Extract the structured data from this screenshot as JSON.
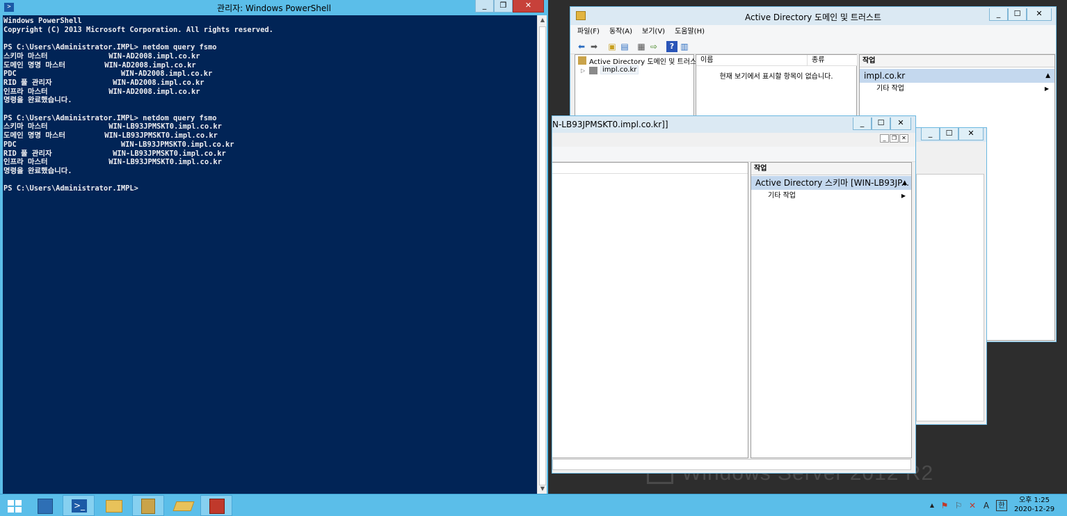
{
  "desktop": {
    "watermark": "Windows Server 2012 R2"
  },
  "powershell": {
    "title": "관리자: Windows PowerShell",
    "lines": [
      "Windows PowerShell",
      "Copyright (C) 2013 Microsoft Corporation. All rights reserved.",
      "",
      "PS C:\\Users\\Administrator.IMPL> netdom query fsmo",
      "스키마 마스터              WIN-AD2008.impl.co.kr",
      "도메인 명명 마스터         WIN-AD2008.impl.co.kr",
      "PDC                        WIN-AD2008.impl.co.kr",
      "RID 풀 관리자              WIN-AD2008.impl.co.kr",
      "인프라 마스터              WIN-AD2008.impl.co.kr",
      "명령을 완료했습니다.",
      "",
      "PS C:\\Users\\Administrator.IMPL> netdom query fsmo",
      "스키마 마스터              WIN-LB93JPMSKT0.impl.co.kr",
      "도메인 명명 마스터         WIN-LB93JPMSKT0.impl.co.kr",
      "PDC                        WIN-LB93JPMSKT0.impl.co.kr",
      "RID 풀 관리자              WIN-LB93JPMSKT0.impl.co.kr",
      "인프라 마스터              WIN-LB93JPMSKT0.impl.co.kr",
      "명령을 완료했습니다.",
      "",
      "PS C:\\Users\\Administrator.IMPL>"
    ]
  },
  "ad_trusts": {
    "title": "Active Directory 도메인 및 트러스트",
    "menu": [
      "파일(F)",
      "동작(A)",
      "보기(V)",
      "도움말(H)"
    ],
    "tree_root": "Active Directory 도메인 및 트러스트",
    "tree_child": "impl.co.kr",
    "columns": [
      "이름",
      "종류"
    ],
    "empty_message": "현재 보기에서 표시할 항목이 없습니다.",
    "actions_header": "작업",
    "actions_selected": "impl.co.kr",
    "actions_more": "기타 작업"
  },
  "schema": {
    "title_fragment": "N-LB93JPMSKT0.impl.co.kr]]",
    "actions_header": "작업",
    "actions_selected": "Active Directory 스키마 [WIN-LB93JP...",
    "actions_more": "기타 작업"
  },
  "taskbar": {
    "time": "오후 1:25",
    "date": "2020-12-29"
  },
  "colors": {
    "ps_background": "#012456",
    "taskbar": "#5bbee9",
    "selection": "#c4d8ee"
  }
}
